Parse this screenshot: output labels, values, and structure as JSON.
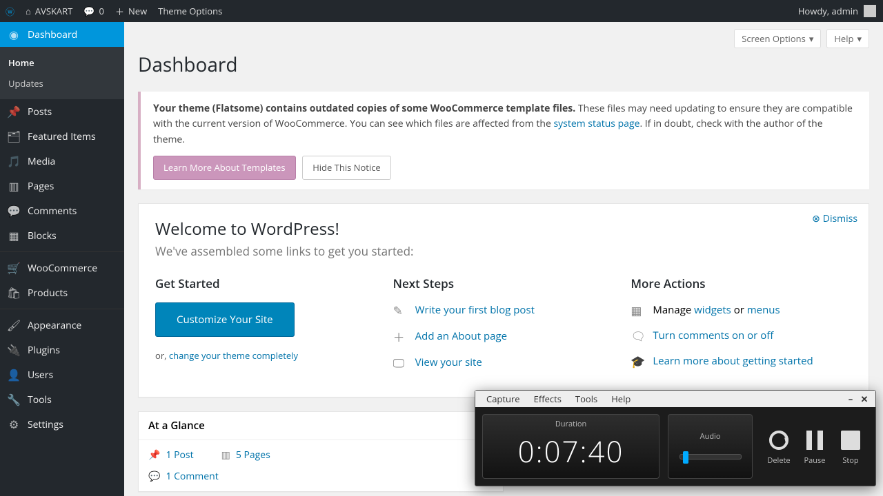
{
  "topbar": {
    "site_name": "AVSKART",
    "comments_count": "0",
    "new_label": "New",
    "theme_options": "Theme Options",
    "greeting": "Howdy, admin"
  },
  "sidebar": {
    "dashboard": "Dashboard",
    "sub_home": "Home",
    "sub_updates": "Updates",
    "posts": "Posts",
    "featured": "Featured Items",
    "media": "Media",
    "pages": "Pages",
    "comments": "Comments",
    "blocks": "Blocks",
    "woocommerce": "WooCommerce",
    "products": "Products",
    "appearance": "Appearance",
    "plugins": "Plugins",
    "users": "Users",
    "tools": "Tools",
    "settings": "Settings"
  },
  "content": {
    "screen_options": "Screen Options",
    "help": "Help",
    "page_title": "Dashboard"
  },
  "notice": {
    "bold": "Your theme (Flatsome) contains outdated copies of some WooCommerce template files.",
    "rest1": " These files may need updating to ensure they are compatible with the current version of WooCommerce. You can see which files are affected from the ",
    "link": "system status page",
    "rest2": ". If in doubt, check with the author of the theme.",
    "btn_learn": "Learn More About Templates",
    "btn_hide": "Hide This Notice"
  },
  "welcome": {
    "dismiss": "Dismiss",
    "title": "Welcome to WordPress!",
    "subtitle": "We've assembled some links to get you started:",
    "col1_title": "Get Started",
    "customize_btn": "Customize Your Site",
    "or_prefix": "or, ",
    "or_link": "change your theme completely",
    "col2_title": "Next Steps",
    "ns1": "Write your first blog post",
    "ns2": "Add an About page",
    "ns3": "View your site",
    "col3_title": "More Actions",
    "ma1_pre": "Manage ",
    "ma1_a": "widgets",
    "ma1_mid": " or ",
    "ma1_b": "menus",
    "ma2": "Turn comments on or off",
    "ma3": "Learn more about getting started"
  },
  "glance": {
    "title": "At a Glance",
    "posts": "1 Post",
    "pages": "5 Pages",
    "comments": "1 Comment"
  },
  "recorder": {
    "menu_capture": "Capture",
    "menu_effects": "Effects",
    "menu_tools": "Tools",
    "menu_help": "Help",
    "duration_label": "Duration",
    "duration_value": "0:07:40",
    "audio_label": "Audio",
    "delete": "Delete",
    "pause": "Pause",
    "stop": "Stop"
  }
}
